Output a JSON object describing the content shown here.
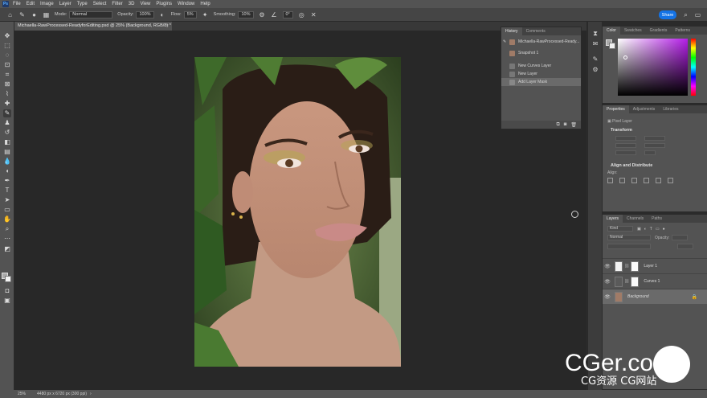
{
  "menubar": {
    "logo": "Ps",
    "items": [
      "File",
      "Edit",
      "Image",
      "Layer",
      "Type",
      "Select",
      "Filter",
      "3D",
      "View",
      "Plugins",
      "Window",
      "Help"
    ]
  },
  "options": {
    "mode_label": "Mode:",
    "mode_value": "Normal",
    "opacity_label": "Opacity:",
    "opacity_value": "100%",
    "flow_label": "Flow:",
    "flow_value": "5%",
    "smoothing_label": "Smoothing:",
    "smoothing_value": "10%",
    "angle_value": "0°",
    "share_label": "Share"
  },
  "document": {
    "tab_title": "Michaella-RawProcessed-ReadyforEditing.psd @ 25% (Background, RGB/8) *",
    "close": "×"
  },
  "history": {
    "tabs": [
      "History",
      "Comments"
    ],
    "items": [
      {
        "label": "Michaella-RawProcessed-Ready..."
      },
      {
        "label": "Snapshot 1"
      },
      {
        "label": "New Curves Layer"
      },
      {
        "label": "New Layer"
      },
      {
        "label": "Add Layer Mask"
      }
    ]
  },
  "color_panel": {
    "tabs": [
      "Color",
      "Swatches",
      "Gradients",
      "Patterns"
    ]
  },
  "properties": {
    "tabs": [
      "Properties",
      "Adjustments",
      "Libraries"
    ],
    "pixel_layer": "Pixel Layer",
    "transform_title": "Transform",
    "align_title": "Align and Distribute",
    "align_label": "Align:"
  },
  "layers": {
    "tabs": [
      "Layers",
      "Channels",
      "Paths"
    ],
    "kind_label": "Kind",
    "blend_mode": "Normal",
    "opacity_label": "Opacity:",
    "items": [
      {
        "name": "Layer 1"
      },
      {
        "name": "Curves 1"
      },
      {
        "name": "Background"
      }
    ]
  },
  "status": {
    "zoom": "25%",
    "doc_size": "4480 px x 6720 px (300 ppi)"
  },
  "watermark": {
    "big": "CGer.com",
    "small": "CG资源 CG网站"
  }
}
